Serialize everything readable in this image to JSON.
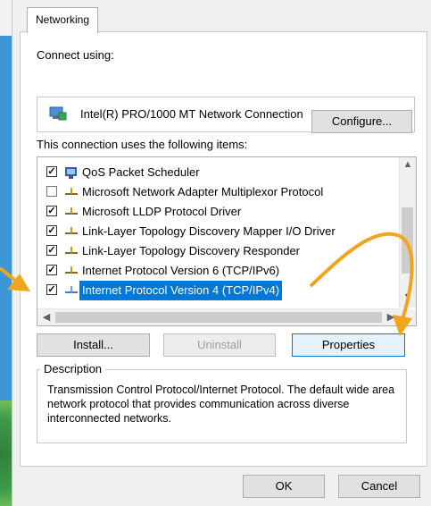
{
  "dialog": {
    "tab_label": "Networking",
    "connect_using_label": "Connect using:",
    "adapter_name": "Intel(R) PRO/1000 MT Network Connection",
    "configure_label": "Configure...",
    "items_label": "This connection uses the following items:",
    "items": [
      {
        "label": "QoS Packet Scheduler",
        "checked": true,
        "icon": "qos-icon"
      },
      {
        "label": "Microsoft Network Adapter Multiplexor Protocol",
        "checked": false,
        "icon": "protocol-icon"
      },
      {
        "label": "Microsoft LLDP Protocol Driver",
        "checked": true,
        "icon": "protocol-icon"
      },
      {
        "label": "Link-Layer Topology Discovery Mapper I/O Driver",
        "checked": true,
        "icon": "protocol-icon"
      },
      {
        "label": "Link-Layer Topology Discovery Responder",
        "checked": true,
        "icon": "protocol-icon"
      },
      {
        "label": "Internet Protocol Version 6 (TCP/IPv6)",
        "checked": true,
        "icon": "protocol-icon"
      },
      {
        "label": "Internet Protocol Version 4 (TCP/IPv4)",
        "checked": true,
        "icon": "protocol-icon",
        "selected": true
      }
    ],
    "install_label": "Install...",
    "uninstall_label": "Uninstall",
    "properties_label": "Properties",
    "description_title": "Description",
    "description_text": "Transmission Control Protocol/Internet Protocol. The default wide area network protocol that provides communication across diverse interconnected networks.",
    "ok_label": "OK",
    "cancel_label": "Cancel"
  },
  "colors": {
    "selection": "#0078d7",
    "annotation_arrow": "#f2a41c",
    "background_blue": "#2e86c8"
  }
}
